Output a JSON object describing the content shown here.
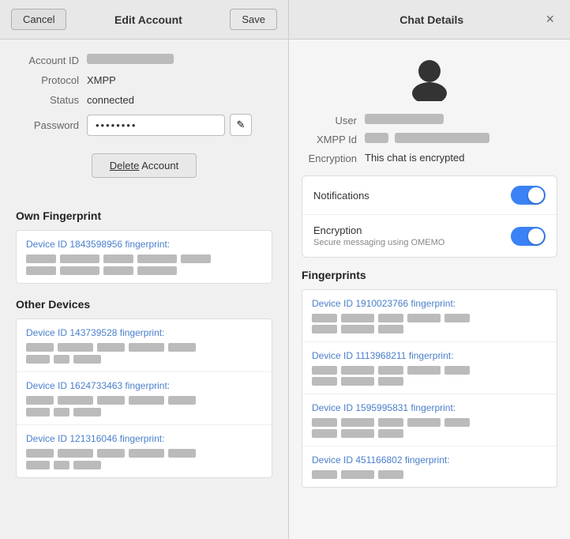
{
  "left": {
    "cancel_label": "Cancel",
    "title": "Edit Account",
    "save_label": "Save",
    "account_id_label": "Account ID",
    "protocol_label": "Protocol",
    "protocol_value": "XMPP",
    "status_label": "Status",
    "status_value": "connected",
    "password_label": "Password",
    "password_value": "••••••••",
    "edit_icon": "✎",
    "delete_label_pre": "Delete",
    "delete_label_post": " Account",
    "own_fingerprint_title": "Own Fingerprint",
    "own_device_id_text": "Device ID 1843598956 fingerprint:",
    "other_devices_title": "Other Devices",
    "devices": [
      {
        "id_text": "Device ID 143739528 fingerprint:",
        "chunks": [
          4,
          5,
          4,
          5,
          4
        ]
      },
      {
        "id_text": "Device ID 1624733463 fingerprint:",
        "chunks": [
          4,
          5,
          4,
          5,
          4
        ]
      },
      {
        "id_text": "Device ID 121316046 fingerprint:",
        "chunks": [
          4,
          5,
          4,
          5,
          4
        ]
      }
    ]
  },
  "right": {
    "title": "Chat Details",
    "close_label": "×",
    "user_label": "User",
    "xmpp_id_label": "XMPP Id",
    "encryption_label": "Encryption",
    "encryption_value": "This chat is encrypted",
    "notifications_label": "Notifications",
    "encryption_setting_label": "Encryption",
    "encryption_setting_sublabel": "Secure messaging using OMEMO",
    "fingerprints_title": "Fingerprints",
    "fp_items": [
      {
        "id_text": "Device ID 1910023766 fingerprint:"
      },
      {
        "id_text": "Device ID 1113968211 fingerprint:"
      },
      {
        "id_text": "Device ID 1595995831 fingerprint:"
      },
      {
        "id_text": "Device ID 451166802 fingerprint:"
      }
    ]
  }
}
